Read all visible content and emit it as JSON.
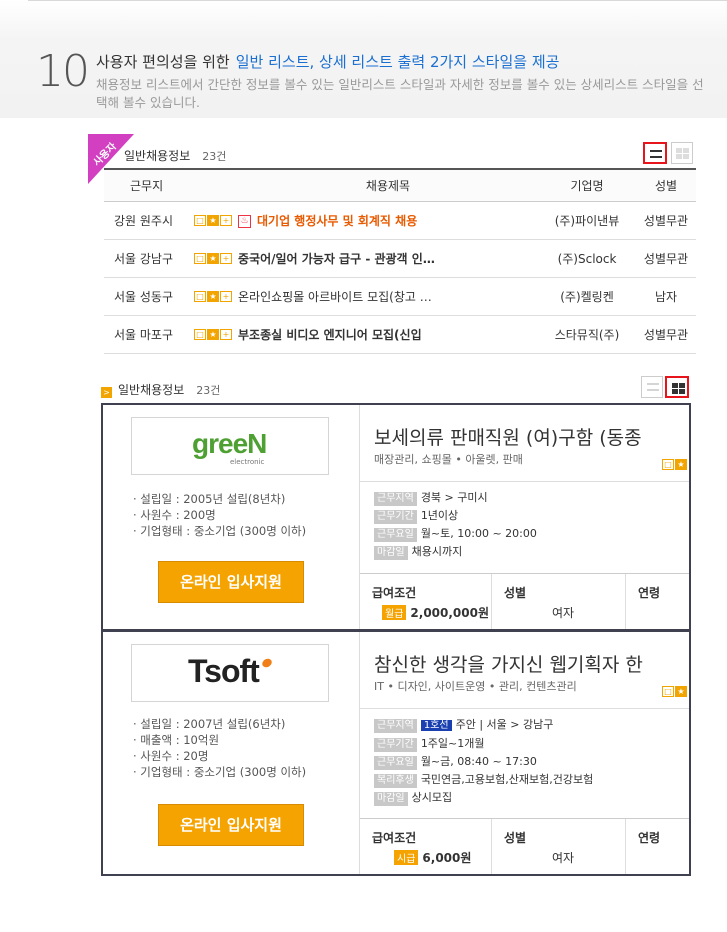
{
  "section": {
    "number": "10",
    "title_plain": "사용자 편의성을 위한",
    "title_highlight": "일반 리스트, 상세 리스트 출력 2가지 스타일을 제공",
    "desc": "채용정보 리스트에서 간단한 정보를 볼수 있는 일반리스트 스타일과 자세한 정보를 볼수 있는 상세리스트 스타일을 선택해 볼수 있습니다."
  },
  "list_view": {
    "ribbon": "사용자",
    "heading": "일반채용정보",
    "count": "23건",
    "columns": [
      "근무지",
      "채용제목",
      "기업명",
      "성별"
    ],
    "rows": [
      {
        "location": "강원 원주시",
        "title": "대기업 행정사무 및 회계직 채용",
        "company": "(주)파이낸뷰",
        "gender": "성별무관",
        "style": "orange"
      },
      {
        "location": "서울 강남구",
        "title": "중국어/일어 가능자 급구 - 관광객 인…",
        "company": "(주)Sclock",
        "gender": "성별무관",
        "style": "bold"
      },
      {
        "location": "서울 성동구",
        "title": "온라인쇼핑몰 아르바이트 모집(창고 …",
        "company": "(주)켈링켄",
        "gender": "남자",
        "style": "normal"
      },
      {
        "location": "서울 마포구",
        "title": "부조종실 비디오 엔지니어 모집(신입",
        "company": "스타뮤직(주)",
        "gender": "성별무관",
        "style": "bold"
      }
    ]
  },
  "grid_view": {
    "heading": "일반채용정보",
    "count": "23건",
    "cards": [
      {
        "logo_text": "greeN",
        "logo_sub": "electronic",
        "info": [
          "· 설립일 : 2005년 설립(8년차)",
          "· 사원수 : 200명",
          "· 기업형태 : 중소기업 (300명 이하)"
        ],
        "apply": "온라인 입사지원",
        "title": "보세의류 판매직원 (여)구함 (동종",
        "category": "매장관리, 쇼핑몰 • 아울렛, 판매",
        "details": [
          {
            "label": "근무지역",
            "value": "경북 > 구미시"
          },
          {
            "label": "근무기간",
            "value": "1년이상"
          },
          {
            "label": "근무요일",
            "value": "월~토, 10:00 ~ 20:00"
          },
          {
            "label": "마감일",
            "value": "채용시까지"
          }
        ],
        "salary_h": "급여조건",
        "salary_tag": "월급",
        "salary": "2,000,000원",
        "gender_h": "성별",
        "gender": "여자",
        "age_h": "연령"
      },
      {
        "logo_text": "Tsoft",
        "info": [
          "· 설립일 : 2007년 설립(6년차)",
          "· 매출액 : 10억원",
          "· 사원수 : 20명",
          "· 기업형태 : 중소기업 (300명 이하)"
        ],
        "apply": "온라인 입사지원",
        "title": "참신한 생각을 가지신 웹기획자 한",
        "category": "IT • 디자인, 사이트운영 • 관리, 컨텐츠관리",
        "details": [
          {
            "label": "근무지역",
            "tag": "1호선",
            "value": "주안 | 서울 > 강남구"
          },
          {
            "label": "근무기간",
            "value": "1주일~1개월"
          },
          {
            "label": "근무요일",
            "value": "월~금, 08:40 ~ 17:30"
          },
          {
            "label": "복리후생",
            "value": "국민연금,고용보험,산재보험,건강보험"
          },
          {
            "label": "마감일",
            "value": "상시모집"
          }
        ],
        "salary_h": "급여조건",
        "salary_tag": "시급",
        "salary": "6,000원",
        "gender_h": "성별",
        "gender": "여자",
        "age_h": "연령"
      }
    ]
  },
  "colors": {
    "accent_blue": "#1a6fd1",
    "orange": "#f5a300",
    "highlight_red": "#e8141b",
    "ribbon": "#d23fc1"
  }
}
